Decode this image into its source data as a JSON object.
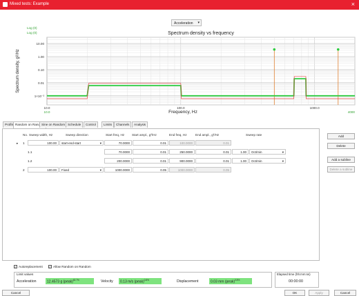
{
  "window": {
    "title": "Mixed tests: Example"
  },
  "mode": {
    "selected": "Acceleration"
  },
  "legend": {
    "log0": "Log (0)",
    "log00": "Log (0)"
  },
  "chart_data": {
    "type": "line",
    "title": "Spectrum density vs frequency",
    "xlabel": "Frequency, Hz",
    "ylabel": "Spectrum density, g²/Hz",
    "xscale": "log",
    "yscale": "log",
    "xlim": [
      10,
      2000
    ],
    "ylim": [
      0.0002,
      30
    ],
    "x_ticks": [
      "10.0",
      "100.0",
      "1000.0"
    ],
    "x_ticks_secondary": [
      "10.0",
      "4000"
    ],
    "y_ticks": [
      "10.00",
      "1.00",
      "0.10",
      "0.01",
      "1×10⁻³"
    ],
    "grid": true,
    "series": [
      {
        "color": "#2ecc40",
        "x": [
          10,
          20,
          20.5,
          100,
          101,
          700,
          705,
          860,
          865,
          2000
        ],
        "y": [
          0.001,
          0.001,
          0.006,
          0.006,
          0.001,
          0.001,
          0.02,
          0.02,
          0.001,
          0.001
        ]
      },
      {
        "color": "#e04040",
        "x": [
          10,
          20,
          20.5,
          100,
          101,
          700,
          705,
          860,
          865,
          2000
        ],
        "y": [
          0.0006,
          0.0006,
          0.009,
          0.009,
          0.0006,
          0.0006,
          0.03,
          0.03,
          0.0006,
          0.0006
        ]
      }
    ],
    "sine_lines": [
      {
        "x": 500,
        "y": 3.5
      },
      {
        "x": 1500,
        "y": 3.5
      }
    ]
  },
  "tabs": [
    "Profile",
    "Random on Random",
    "Sine on Random",
    "Schedule",
    "Control",
    "Limits",
    "Channels",
    "Analysis"
  ],
  "table": {
    "headers": [
      "No.",
      "Sweep width, Hz",
      "Sweep direction",
      "Start freq, Hz",
      "Start ampl., g²/Hz",
      "End freq, Hz",
      "End ampl., g²/Hz",
      "Sweep rate"
    ],
    "rows": [
      {
        "no": "1",
        "width": "100.00",
        "dir": "start-end-start",
        "sf": "70.0000",
        "sa": "0.01",
        "ef": "100.0000",
        "ea": "0.01",
        "rate": "",
        "unit": ""
      },
      {
        "no": "1.1",
        "width": "",
        "dir": "",
        "sf": "70.0000",
        "sa": "0.01",
        "ef": "250.0000",
        "ea": "0.01",
        "rate": "1.00",
        "unit": "Oct/min"
      },
      {
        "no": "1.2",
        "width": "",
        "dir": "",
        "sf": "200.0000",
        "sa": "0.01",
        "ef": "900.0000",
        "ea": "0.01",
        "rate": "1.00",
        "unit": "Oct/min"
      },
      {
        "no": "2",
        "width": "100.00",
        "dir": "Fixed",
        "sf": "1000.0000",
        "sa": "0.05",
        "ef": "1000.0000",
        "ea": "0.05",
        "rate": "",
        "unit": ""
      }
    ]
  },
  "side_buttons": [
    "Add",
    "Delete",
    "Add a subline",
    "Delete a subline"
  ],
  "checkboxes": {
    "auto": "Autoreplacement",
    "allow": "Allow Random on Random"
  },
  "limits": {
    "group": "Limit values",
    "acc_label": "Acceleration",
    "acc_value": "12.4573 g (peak)",
    "acc_pct": "82.7%",
    "vel_label": "Velocity",
    "vel_value": "0.13 m/s (peak)",
    "vel_pct": "0.8%",
    "disp_label": "Displacement",
    "disp_value": "0.03 mm (peak)",
    "disp_pct": "0.8%"
  },
  "elapsed": {
    "label": "Elapsed time (hh:mm:ss)",
    "value": "00:00:00"
  },
  "footer": {
    "cancel": "Cancel",
    "ok": "OK",
    "apply": "Apply",
    "close": "Cancel"
  }
}
